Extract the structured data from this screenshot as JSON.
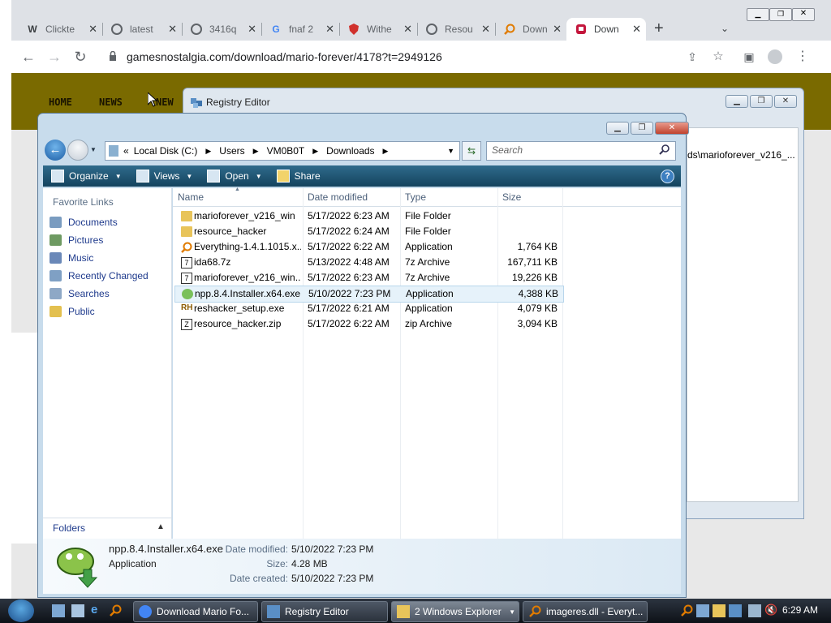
{
  "browser": {
    "tabs": [
      {
        "label": "Clickte",
        "icon": "W"
      },
      {
        "label": "latest",
        "icon": "globe"
      },
      {
        "label": "3416q",
        "icon": "globe"
      },
      {
        "label": "fnaf 2",
        "icon": "G"
      },
      {
        "label": "Withe",
        "icon": "shield"
      },
      {
        "label": "Resou",
        "icon": "globe"
      },
      {
        "label": "Down",
        "icon": "magnifier"
      },
      {
        "label": "Down",
        "icon": "gem",
        "active": true
      }
    ],
    "url": "gamesnostalgia.com/download/mario-forever/4178?t=2949126"
  },
  "website": {
    "nav": [
      "HOME",
      "NEWS",
      "NEW"
    ]
  },
  "registry_editor": {
    "title": "Registry Editor",
    "path_fragment": "ds\\marioforever_v216_..."
  },
  "explorer": {
    "breadcrumb": [
      "Local Disk (C:)",
      "Users",
      "VM0B0T",
      "Downloads"
    ],
    "search_placeholder": "Search",
    "commands": [
      "Organize",
      "Views",
      "Open",
      "Share"
    ],
    "favorites_header": "Favorite Links",
    "favorites": [
      "Documents",
      "Pictures",
      "Music",
      "Recently Changed",
      "Searches",
      "Public"
    ],
    "folders_label": "Folders",
    "columns": [
      "Name",
      "Date modified",
      "Type",
      "Size"
    ],
    "files": [
      {
        "name": "marioforever_v216_win",
        "date": "5/17/2022 6:23 AM",
        "type": "File Folder",
        "size": "",
        "icon": "folder"
      },
      {
        "name": "resource_hacker",
        "date": "5/17/2022 6:24 AM",
        "type": "File Folder",
        "size": "",
        "icon": "folder"
      },
      {
        "name": "Everything-1.4.1.1015.x...",
        "date": "5/17/2022 6:22 AM",
        "type": "Application",
        "size": "1,764 KB",
        "icon": "magnifier"
      },
      {
        "name": "ida68.7z",
        "date": "5/13/2022 4:48 AM",
        "type": "7z Archive",
        "size": "167,711 KB",
        "icon": "archive"
      },
      {
        "name": "marioforever_v216_win...",
        "date": "5/17/2022 6:23 AM",
        "type": "7z Archive",
        "size": "19,226 KB",
        "icon": "archive"
      },
      {
        "name": "npp.8.4.Installer.x64.exe",
        "date": "5/10/2022 7:23 PM",
        "type": "Application",
        "size": "4,388 KB",
        "icon": "npp",
        "selected": true
      },
      {
        "name": "reshacker_setup.exe",
        "date": "5/17/2022 6:21 AM",
        "type": "Application",
        "size": "4,079 KB",
        "icon": "rh"
      },
      {
        "name": "resource_hacker.zip",
        "date": "5/17/2022 6:22 AM",
        "type": "zip Archive",
        "size": "3,094 KB",
        "icon": "archive"
      }
    ],
    "details": {
      "name": "npp.8.4.Installer.x64.exe",
      "type": "Application",
      "date_modified_label": "Date modified:",
      "date_modified": "5/10/2022 7:23 PM",
      "size_label": "Size:",
      "size": "4.28 MB",
      "date_created_label": "Date created:",
      "date_created": "5/10/2022 7:23 PM"
    }
  },
  "taskbar": {
    "buttons": [
      "Download Mario Fo...",
      "Registry Editor",
      "2 Windows Explorer",
      "imageres.dll - Everyt..."
    ],
    "clock": "6:29 AM"
  }
}
